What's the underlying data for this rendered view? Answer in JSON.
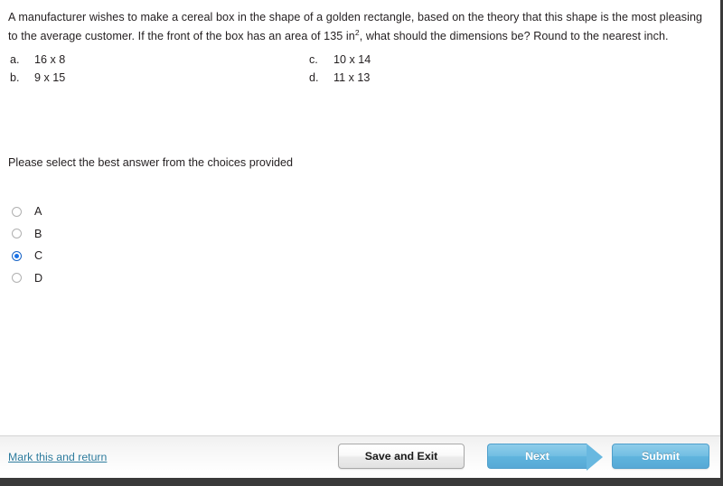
{
  "question": {
    "text_part1": "A manufacturer wishes to make a cereal box in the shape of a golden rectangle, based on the theory that this shape is the most pleasing to the average customer. If the front of the box has an area of 135 in",
    "superscript": "2",
    "text_part2": ",  what should the dimensions be? Round to the nearest inch."
  },
  "choices": [
    {
      "key": "a.",
      "value": "16 x 8"
    },
    {
      "key": "b.",
      "value": "9 x 15"
    },
    {
      "key": "c.",
      "value": "10 x 14"
    },
    {
      "key": "d.",
      "value": "11 x 13"
    }
  ],
  "prompt": "Please select the best answer from the choices provided",
  "answer_options": [
    {
      "label": "A",
      "selected": false
    },
    {
      "label": "B",
      "selected": false
    },
    {
      "label": "C",
      "selected": true
    },
    {
      "label": "D",
      "selected": false
    }
  ],
  "footer": {
    "mark_return_label": "Mark this and return",
    "save_label": "Save and Exit",
    "next_label": "Next",
    "submit_label": "Submit"
  },
  "colors": {
    "link": "#2e7c9e",
    "button_blue": "#5fb4dd",
    "radio_selected": "#1a73e8",
    "text": "#231f20",
    "footer_border": "#d4d4d4",
    "window_chrome": "#3a3a3a"
  }
}
